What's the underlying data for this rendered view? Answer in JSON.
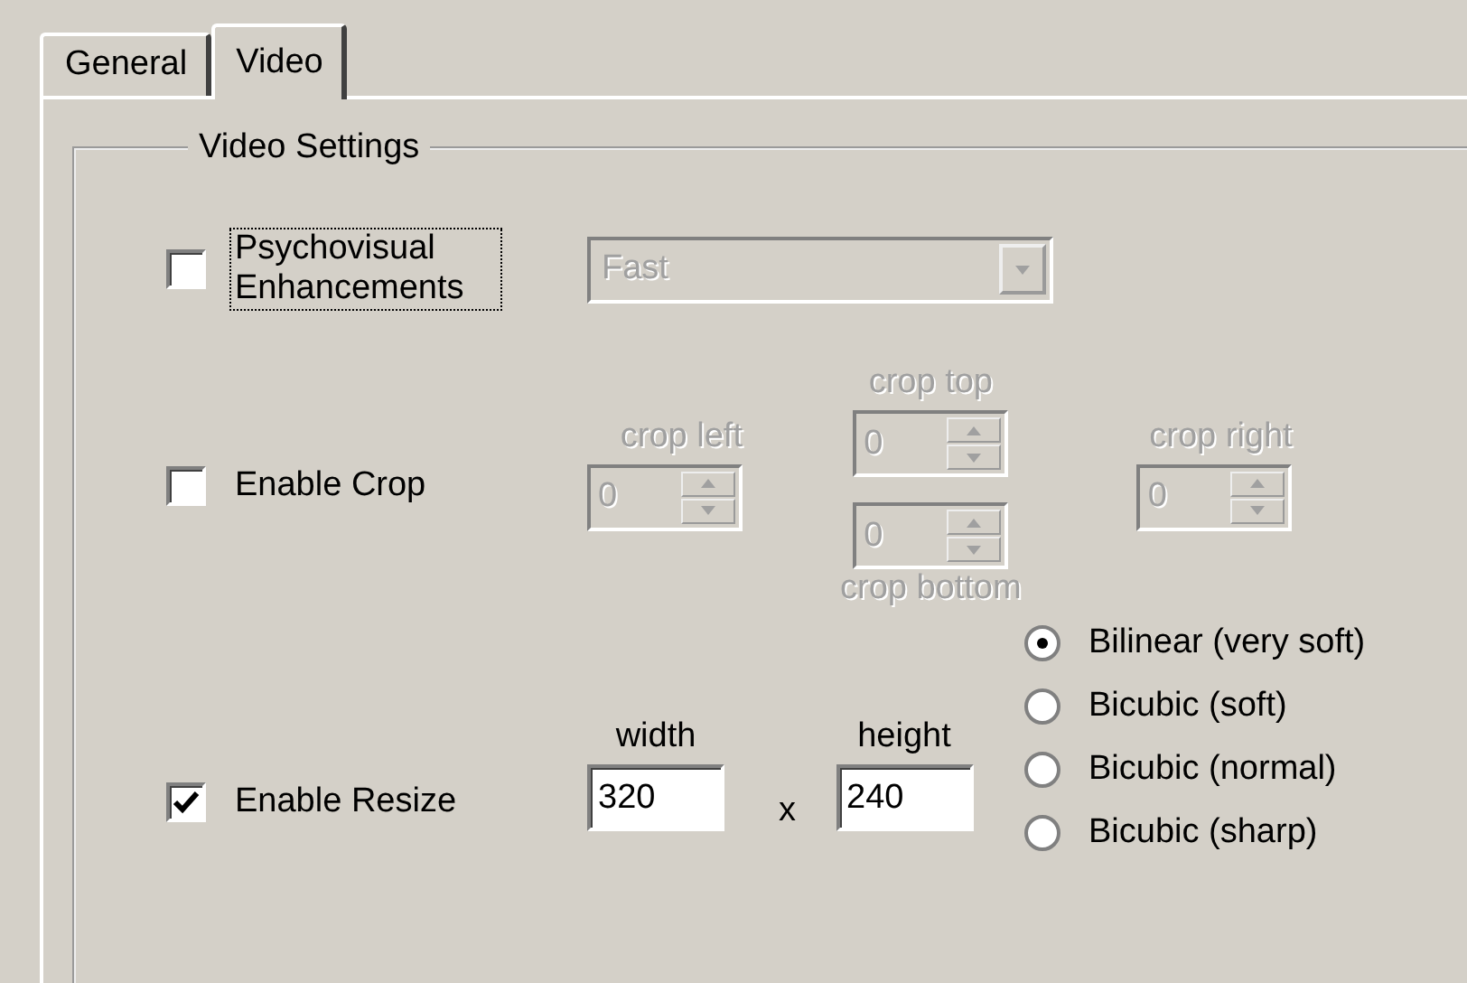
{
  "tabs": [
    {
      "label": "General",
      "selected": false
    },
    {
      "label": "Video",
      "selected": true
    }
  ],
  "group": {
    "title": "Video Settings"
  },
  "psychovisual": {
    "label": "Psychovisual Enhancements",
    "checked": false,
    "focused": true,
    "mode": {
      "value": "Fast",
      "disabled": true
    }
  },
  "crop": {
    "label": "Enable Crop",
    "checked": false,
    "left": {
      "label": "crop left",
      "value": "0",
      "disabled": true
    },
    "top": {
      "label": "crop top",
      "value": "0",
      "disabled": true
    },
    "bottom": {
      "label": "crop bottom",
      "value": "0",
      "disabled": true
    },
    "right": {
      "label": "crop right",
      "value": "0",
      "disabled": true
    }
  },
  "resize": {
    "label": "Enable Resize",
    "checked": true,
    "width": {
      "label": "width",
      "value": "320"
    },
    "separator": "x",
    "height": {
      "label": "height",
      "value": "240"
    },
    "filters": [
      {
        "label": "Bilinear (very soft)",
        "selected": true
      },
      {
        "label": "Bicubic (soft)",
        "selected": false
      },
      {
        "label": "Bicubic (normal)",
        "selected": false
      },
      {
        "label": "Bicubic (sharp)",
        "selected": false
      }
    ]
  }
}
